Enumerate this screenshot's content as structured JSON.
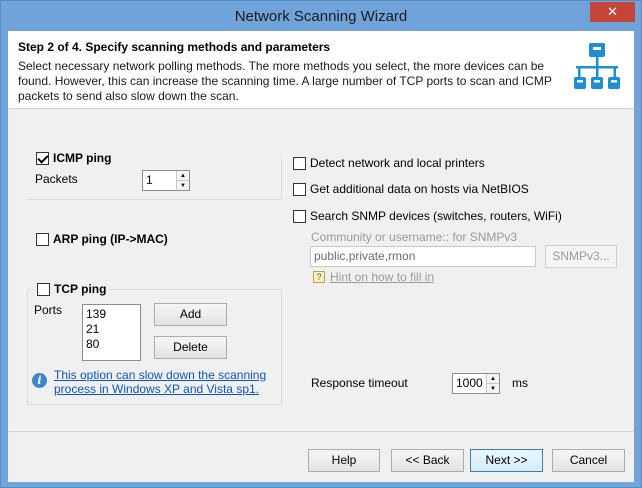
{
  "window": {
    "title": "Network Scanning Wizard",
    "close_label": "✕"
  },
  "header": {
    "title": "Step 2 of 4. Specify scanning methods and parameters",
    "description": "Select necessary network polling methods. The more methods you select, the more devices can be found. However, this can increase the scanning time. A large number of TCP ports to scan and ICMP packets to send also slow down the scan.",
    "icon": "network-topology-icon"
  },
  "icmp": {
    "label": "ICMP ping",
    "checked": true,
    "packets_label": "Packets",
    "packets_value": "1"
  },
  "arp": {
    "label": "ARP ping (IP->MAC)",
    "checked": false
  },
  "tcp": {
    "label": "TCP ping",
    "checked": false,
    "ports_label": "Ports",
    "ports": [
      "139",
      "21",
      "80"
    ],
    "add_label": "Add",
    "delete_label": "Delete",
    "info_text": "This option can slow down the scanning process in Windows XP and Vista sp1."
  },
  "options": {
    "detect_printers": {
      "label": "Detect network and local printers",
      "checked": false
    },
    "netbios": {
      "label": "Get additional data on hosts via NetBIOS",
      "checked": false
    },
    "snmp": {
      "label": "Search SNMP devices (switches, routers, WiFi)",
      "checked": false
    },
    "community_label": "Community or username:: for SNMPv3",
    "community_value": "public,private,rmon",
    "snmpv3_button": "SNMPv3...",
    "hint_text": "Hint on how to fill in"
  },
  "timeout": {
    "label": "Response timeout",
    "value": "1000",
    "unit": "ms"
  },
  "buttons": {
    "help": "Help",
    "back": "<< Back",
    "next": "Next >>",
    "cancel": "Cancel"
  },
  "colors": {
    "titlebar": "#6fa3d9",
    "close": "#c7463a",
    "link": "#0b55c4",
    "accent": "#1d8fd6"
  }
}
